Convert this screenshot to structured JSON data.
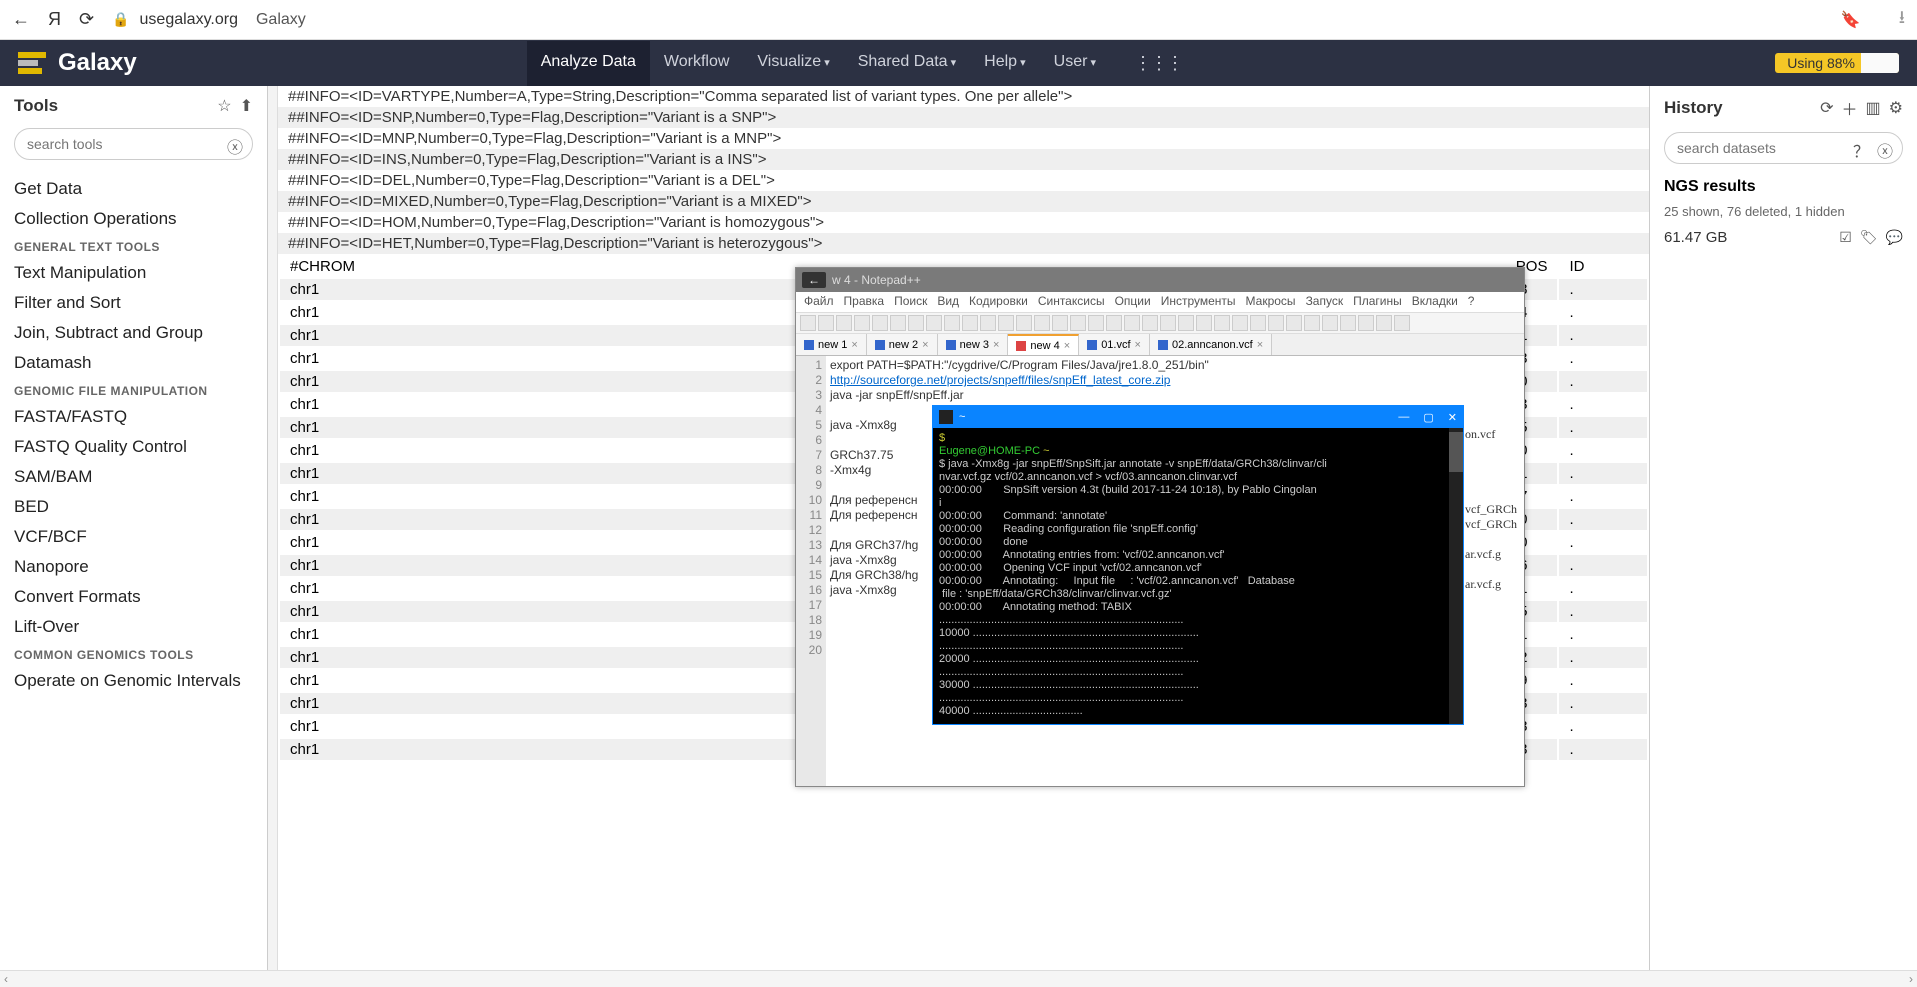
{
  "browser": {
    "url": "usegalaxy.org",
    "title": "Galaxy"
  },
  "topnav": {
    "logo": "Galaxy",
    "menu": [
      "Analyze Data",
      "Workflow",
      "Visualize",
      "Shared Data",
      "Help",
      "User"
    ],
    "quota": "Using 88%"
  },
  "tools": {
    "title": "Tools",
    "placeholder": "search tools",
    "items": [
      {
        "t": "item",
        "label": "Get Data"
      },
      {
        "t": "item",
        "label": "Collection Operations"
      },
      {
        "t": "section",
        "label": "GENERAL TEXT TOOLS"
      },
      {
        "t": "item",
        "label": "Text Manipulation"
      },
      {
        "t": "item",
        "label": "Filter and Sort"
      },
      {
        "t": "item",
        "label": "Join, Subtract and Group"
      },
      {
        "t": "item",
        "label": "Datamash"
      },
      {
        "t": "section",
        "label": "GENOMIC FILE MANIPULATION"
      },
      {
        "t": "item",
        "label": "FASTA/FASTQ"
      },
      {
        "t": "item",
        "label": "FASTQ Quality Control"
      },
      {
        "t": "item",
        "label": "SAM/BAM"
      },
      {
        "t": "item",
        "label": "BED"
      },
      {
        "t": "item",
        "label": "VCF/BCF"
      },
      {
        "t": "item",
        "label": "Nanopore"
      },
      {
        "t": "item",
        "label": "Convert Formats"
      },
      {
        "t": "item",
        "label": "Lift-Over"
      },
      {
        "t": "section",
        "label": "COMMON GENOMICS TOOLS"
      },
      {
        "t": "item",
        "label": "Operate on Genomic Intervals"
      }
    ]
  },
  "vcf_headers": [
    "##INFO=<ID=VARTYPE,Number=A,Type=String,Description=\"Comma separated list of variant types. One per allele\">",
    "##INFO=<ID=SNP,Number=0,Type=Flag,Description=\"Variant is a SNP\">",
    "##INFO=<ID=MNP,Number=0,Type=Flag,Description=\"Variant is a MNP\">",
    "##INFO=<ID=INS,Number=0,Type=Flag,Description=\"Variant is a INS\">",
    "##INFO=<ID=DEL,Number=0,Type=Flag,Description=\"Variant is a DEL\">",
    "##INFO=<ID=MIXED,Number=0,Type=Flag,Description=\"Variant is a MIXED\">",
    "##INFO=<ID=HOM,Number=0,Type=Flag,Description=\"Variant is homozygous\">",
    "##INFO=<ID=HET,Number=0,Type=Flag,Description=\"Variant is heterozygous\">"
  ],
  "vcf_table": {
    "head": [
      "#CHROM",
      "POS",
      "ID"
    ],
    "rows": [
      [
        "chr1",
        "13868",
        "."
      ],
      [
        "chr1",
        "14464",
        "."
      ],
      [
        "chr1",
        "14521",
        "."
      ],
      [
        "chr1",
        "15273",
        "."
      ],
      [
        "chr1",
        "15820",
        "."
      ],
      [
        "chr1",
        "15903",
        "."
      ],
      [
        "chr1",
        "16495",
        "."
      ],
      [
        "chr1",
        "69270",
        "."
      ],
      [
        "chr1",
        "69511",
        "."
      ],
      [
        "chr1",
        "69897",
        "."
      ],
      [
        "chr1",
        "91190",
        "."
      ],
      [
        "chr1",
        "91200",
        "."
      ],
      [
        "chr1",
        "91336",
        "."
      ],
      [
        "chr1",
        "127491",
        "."
      ],
      [
        "chr1",
        "129285",
        "."
      ],
      [
        "chr1",
        "131281",
        "."
      ],
      [
        "chr1",
        "131552",
        "."
      ],
      [
        "chr1",
        "133129",
        "."
      ],
      [
        "chr1",
        "133483",
        "."
      ],
      [
        "chr1",
        "133558",
        "."
      ],
      [
        "chr1",
        "135203",
        "."
      ]
    ]
  },
  "history": {
    "title": "History",
    "placeholder": "search datasets",
    "name": "NGS results",
    "meta": "25 shown, 76 deleted, 1 hidden",
    "size": "61.47 GB"
  },
  "npp": {
    "title": "w 4 - Notepad++",
    "menu": [
      "Файл",
      "Правка",
      "Поиск",
      "Вид",
      "Кодировки",
      "Синтаксисы",
      "Опции",
      "Инструменты",
      "Макросы",
      "Запуск",
      "Плагины",
      "Вкладки",
      "?"
    ],
    "tabs": [
      {
        "label": "new 1",
        "ico": "blue"
      },
      {
        "label": "new 2",
        "ico": "blue"
      },
      {
        "label": "new 3",
        "ico": "blue"
      },
      {
        "label": "new 4",
        "ico": "red",
        "active": true
      },
      {
        "label": "01.vcf",
        "ico": "blue"
      },
      {
        "label": "02.anncanon.vcf",
        "ico": "blue"
      }
    ],
    "lines": [
      "export PATH=$PATH:\"/cygdrive/C/Program Files/Java/jre1.8.0_251/bin\"",
      "http://sourceforge.net/projects/snpeff/files/snpEff_latest_core.zip",
      "java -jar snpEff/snpEff.jar",
      "",
      "java -Xmx8g ",
      "",
      "GRCh37.75",
      "-Xmx4g",
      "",
      "Для референсн",
      "Для референсн",
      "",
      "Для GRCh37/hg",
      "java -Xmx8g ",
      "Для GRCh38/hg",
      "java -Xmx8g ",
      "",
      "",
      "",
      ""
    ],
    "side_text": [
      "on.vcf",
      "",
      "",
      "",
      "",
      "vcf_GRCh",
      "vcf_GRCh",
      "",
      "ar.vcf.g",
      "",
      "ar.vcf.g"
    ]
  },
  "term": {
    "title": "~",
    "lines": [
      {
        "c": "y",
        "t": "$ "
      },
      {
        "c": "g",
        "t": "Eugene@HOME-PC "
      },
      {
        "c": "y",
        "t": "~"
      },
      {
        "c": "",
        "t": "$ java -Xmx8g -jar snpEff/SnpSift.jar annotate -v snpEff/data/GRCh38/clinvar/cli"
      },
      {
        "c": "",
        "t": "nvar.vcf.gz vcf/02.anncanon.vcf > vcf/03.anncanon.clinvar.vcf"
      },
      {
        "c": "",
        "t": "00:00:00       SnpSift version 4.3t (build 2017-11-24 10:18), by Pablo Cingolan"
      },
      {
        "c": "",
        "t": "i"
      },
      {
        "c": "",
        "t": "00:00:00       Command: 'annotate'"
      },
      {
        "c": "",
        "t": "00:00:00       Reading configuration file 'snpEff.config'"
      },
      {
        "c": "",
        "t": "00:00:00       done"
      },
      {
        "c": "",
        "t": "00:00:00       Annotating entries from: 'vcf/02.anncanon.vcf'"
      },
      {
        "c": "",
        "t": "00:00:00       Opening VCF input 'vcf/02.anncanon.vcf'"
      },
      {
        "c": "",
        "t": "00:00:00       Annotating:     Input file     : 'vcf/02.anncanon.vcf'   Database"
      },
      {
        "c": "",
        "t": " file : 'snpEff/data/GRCh38/clinvar/clinvar.vcf.gz'"
      },
      {
        "c": "",
        "t": "00:00:00       Annotating method: TABIX"
      },
      {
        "c": "",
        "t": "................................................................................"
      },
      {
        "c": "",
        "t": "10000 .........................................................................."
      },
      {
        "c": "",
        "t": "................................................................................"
      },
      {
        "c": "",
        "t": "20000 .........................................................................."
      },
      {
        "c": "",
        "t": "................................................................................"
      },
      {
        "c": "",
        "t": "30000 .........................................................................."
      },
      {
        "c": "",
        "t": "................................................................................"
      },
      {
        "c": "",
        "t": "40000 ...................................."
      }
    ]
  }
}
